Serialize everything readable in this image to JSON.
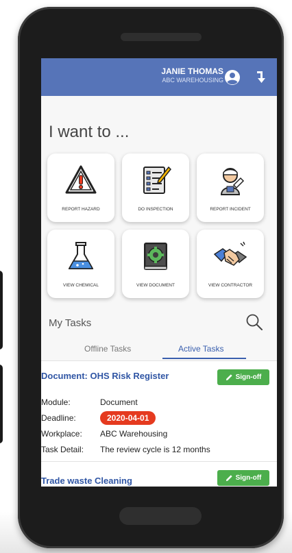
{
  "header": {
    "user_name": "JANIE THOMAS",
    "company": "ABC WAREHOUSING"
  },
  "heading": "I want to ...",
  "actions": [
    {
      "label": "REPORT HAZARD",
      "icon": "warning-icon"
    },
    {
      "label": "DO INSPECTION",
      "icon": "clipboard-checklist-icon"
    },
    {
      "label": "REPORT INCIDENT",
      "icon": "injured-person-icon"
    },
    {
      "label": "VIEW CHEMICAL",
      "icon": "flask-icon"
    },
    {
      "label": "VIEW DOCUMENT",
      "icon": "book-gear-icon"
    },
    {
      "label": "VIEW CONTRACTOR",
      "icon": "handshake-icon"
    }
  ],
  "tasks": {
    "title": "My Tasks",
    "tabs": [
      {
        "label": "Offline Tasks",
        "active": false
      },
      {
        "label": "Active Tasks",
        "active": true
      }
    ],
    "items": [
      {
        "title": "Document: OHS Risk Register",
        "signoff_label": "Sign-off",
        "fields": [
          {
            "key": "Module:",
            "value": "Document"
          },
          {
            "key": "Deadline:",
            "value": "2020-04-01"
          },
          {
            "key": "Workplace:",
            "value": "ABC Warehousing"
          },
          {
            "key": "Task Detail:",
            "value": "The review cycle is 12 months"
          }
        ]
      },
      {
        "title": "Trade waste Cleaning",
        "signoff_label": "Sign-off"
      }
    ]
  },
  "colors": {
    "appbar": "#5674b8",
    "accent": "#3a5fae",
    "signoff": "#4cae4c",
    "deadline": "#e53a1f"
  }
}
